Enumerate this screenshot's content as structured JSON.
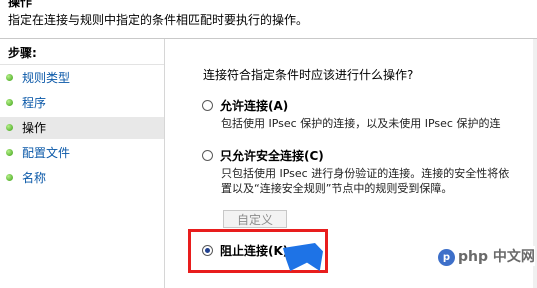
{
  "header": {
    "title": "操作",
    "description": "指定在连接与规则中指定的条件相匹配时要执行的操作。"
  },
  "sidebar": {
    "steps_label": "步骤:",
    "items": [
      {
        "label": "规则类型",
        "active": false
      },
      {
        "label": "程序",
        "active": false
      },
      {
        "label": "操作",
        "active": true
      },
      {
        "label": "配置文件",
        "active": false
      },
      {
        "label": "名称",
        "active": false
      }
    ]
  },
  "content": {
    "question": "连接符合指定条件时应该进行什么操作?",
    "options": [
      {
        "label": "允许连接(A)",
        "description": [
          "包括使用 IPsec 保护的连接，以及未使用 IPsec 保护的连"
        ],
        "checked": false
      },
      {
        "label": "只允许安全连接(C)",
        "description": [
          "只包括使用 IPsec 进行身份验证的连接。连接的安全性将依",
          "置以及“连接安全规则”节点中的规则受到保障。"
        ],
        "checked": false
      },
      {
        "label": "阻止连接(K)",
        "description": [],
        "checked": true
      }
    ],
    "custom_button": "自定义"
  },
  "watermark": {
    "text": "php 中文网"
  }
}
